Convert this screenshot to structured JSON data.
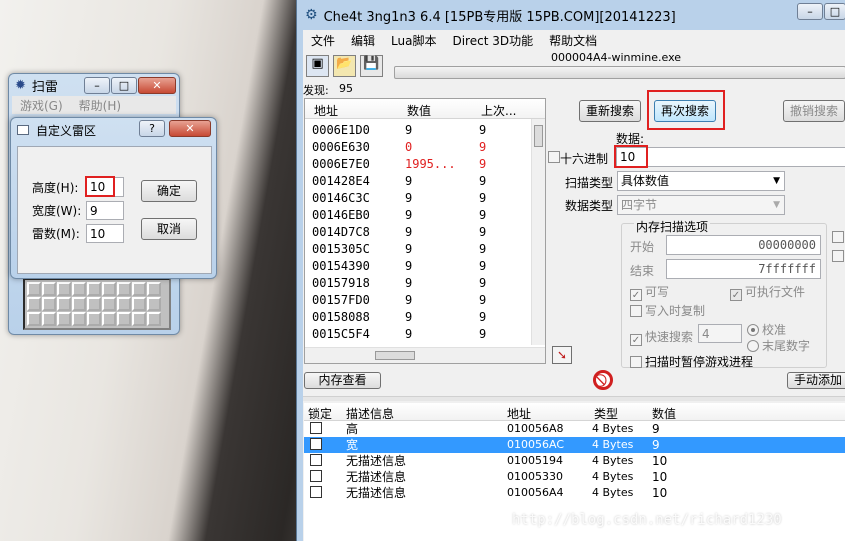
{
  "ce": {
    "title": "Che4t 3ng1n3 6.4 [15PB专用版 15PB.COM][20141223]",
    "menu": [
      "文件",
      "编辑",
      "Lua脚本",
      "Direct 3D功能",
      "帮助文档"
    ],
    "process_name": "000004A4-winmine.exe",
    "found_label": "发现:",
    "found_count": "95",
    "list_headers": {
      "address": "地址",
      "value": "数值",
      "previous": "上次..."
    },
    "scan_results": [
      {
        "address": "0006E1D0",
        "value": "9",
        "previous": "9",
        "changed": false
      },
      {
        "address": "0006E630",
        "value": "0",
        "previous": "9",
        "changed": true
      },
      {
        "address": "0006E7E0",
        "value": "1995...",
        "previous": "9",
        "changed": true
      },
      {
        "address": "001428E4",
        "value": "9",
        "previous": "9",
        "changed": false
      },
      {
        "address": "00146C3C",
        "value": "9",
        "previous": "9",
        "changed": false
      },
      {
        "address": "00146EB0",
        "value": "9",
        "previous": "9",
        "changed": false
      },
      {
        "address": "0014D7C8",
        "value": "9",
        "previous": "9",
        "changed": false
      },
      {
        "address": "0015305C",
        "value": "9",
        "previous": "9",
        "changed": false
      },
      {
        "address": "00154390",
        "value": "9",
        "previous": "9",
        "changed": false
      },
      {
        "address": "00157918",
        "value": "9",
        "previous": "9",
        "changed": false
      },
      {
        "address": "00157FD0",
        "value": "9",
        "previous": "9",
        "changed": false
      },
      {
        "address": "00158088",
        "value": "9",
        "previous": "9",
        "changed": false
      },
      {
        "address": "0015C5F4",
        "value": "9",
        "previous": "9",
        "changed": false
      }
    ],
    "buttons": {
      "new_scan": "重新搜索",
      "next_scan": "再次搜索",
      "undo_scan": "撤销搜索",
      "memory_view": "内存查看",
      "add_manual": "手动添加"
    },
    "value_label": "数据:",
    "hex_label": "十六进制",
    "value_input": "10",
    "scan_type_label": "扫描类型",
    "scan_type_value": "具体数值",
    "value_type_label": "数据类型",
    "value_type_value": "四字节",
    "mem_options": {
      "title": "内存扫描选项",
      "start_label": "开始",
      "start_value": "00000000",
      "stop_label": "结束",
      "stop_value": "7fffffff",
      "writable": "可写",
      "executable": "可执行文件",
      "copy_on_write": "写入时复制",
      "fast_scan": "快速搜索",
      "fast_scan_value": "4",
      "alignment": "校准",
      "last_digits": "末尾数字",
      "pause_game": "扫描时暂停游戏进程"
    },
    "table_headers": {
      "lock": "锁定",
      "desc": "描述信息",
      "address": "地址",
      "type": "类型",
      "value": "数值"
    },
    "address_table": [
      {
        "desc": "高",
        "address": "010056A8",
        "type": "4 Bytes",
        "value": "9",
        "selected": false
      },
      {
        "desc": "宽",
        "address": "010056AC",
        "type": "4 Bytes",
        "value": "9",
        "selected": true
      },
      {
        "desc": "无描述信息",
        "address": "01005194",
        "type": "4 Bytes",
        "value": "10",
        "selected": false
      },
      {
        "desc": "无描述信息",
        "address": "01005330",
        "type": "4 Bytes",
        "value": "10",
        "selected": false
      },
      {
        "desc": "无描述信息",
        "address": "010056A4",
        "type": "4 Bytes",
        "value": "10",
        "selected": false
      }
    ]
  },
  "minesweeper": {
    "title": "扫雷",
    "menu": [
      "游戏(G)",
      "帮助(H)"
    ]
  },
  "custom_dialog": {
    "title": "自定义雷区",
    "height_label": "高度(H):",
    "height_value": "10",
    "width_label": "宽度(W):",
    "width_value": "9",
    "mines_label": "雷数(M):",
    "mines_value": "10",
    "ok": "确定",
    "cancel": "取消"
  },
  "watermark": "http://blog.csdn.net/richard1230",
  "colors": {
    "highlight_red": "#e02020",
    "selection_blue": "#3399ff",
    "changed_value": "#e02020"
  }
}
